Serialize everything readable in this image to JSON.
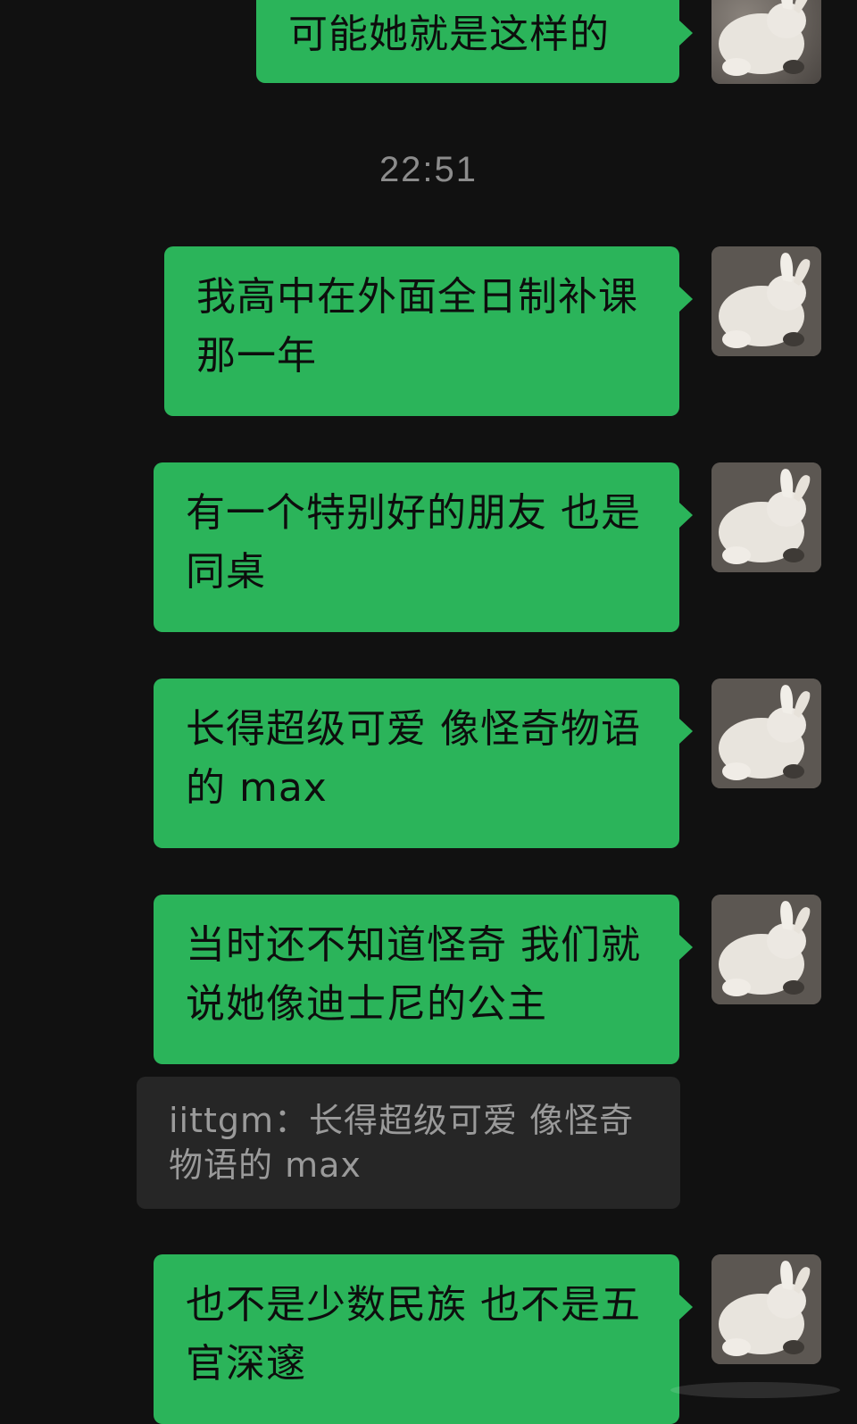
{
  "chat": {
    "timestamp": "22:51",
    "messages": [
      {
        "text": "可能她就是这样的"
      },
      {
        "text": "我高中在外面全日制补课那一年"
      },
      {
        "text": "有一个特别好的朋友 也是同桌"
      },
      {
        "text": "长得超级可爱 像怪奇物语的 max"
      },
      {
        "text": "当时还不知道怪奇 我们就说她像迪士尼的公主"
      },
      {
        "text": "也不是少数民族 也不是五官深邃"
      }
    ],
    "quote": {
      "text": "iittgm：长得超级可爱 像怪奇物语的 max"
    },
    "avatar_icon": "rabbit-avatar-icon",
    "colors": {
      "background": "#111111",
      "bubble": "#2bb45a",
      "quote_background": "#262626",
      "timestamp": "#8c8c8c"
    }
  }
}
